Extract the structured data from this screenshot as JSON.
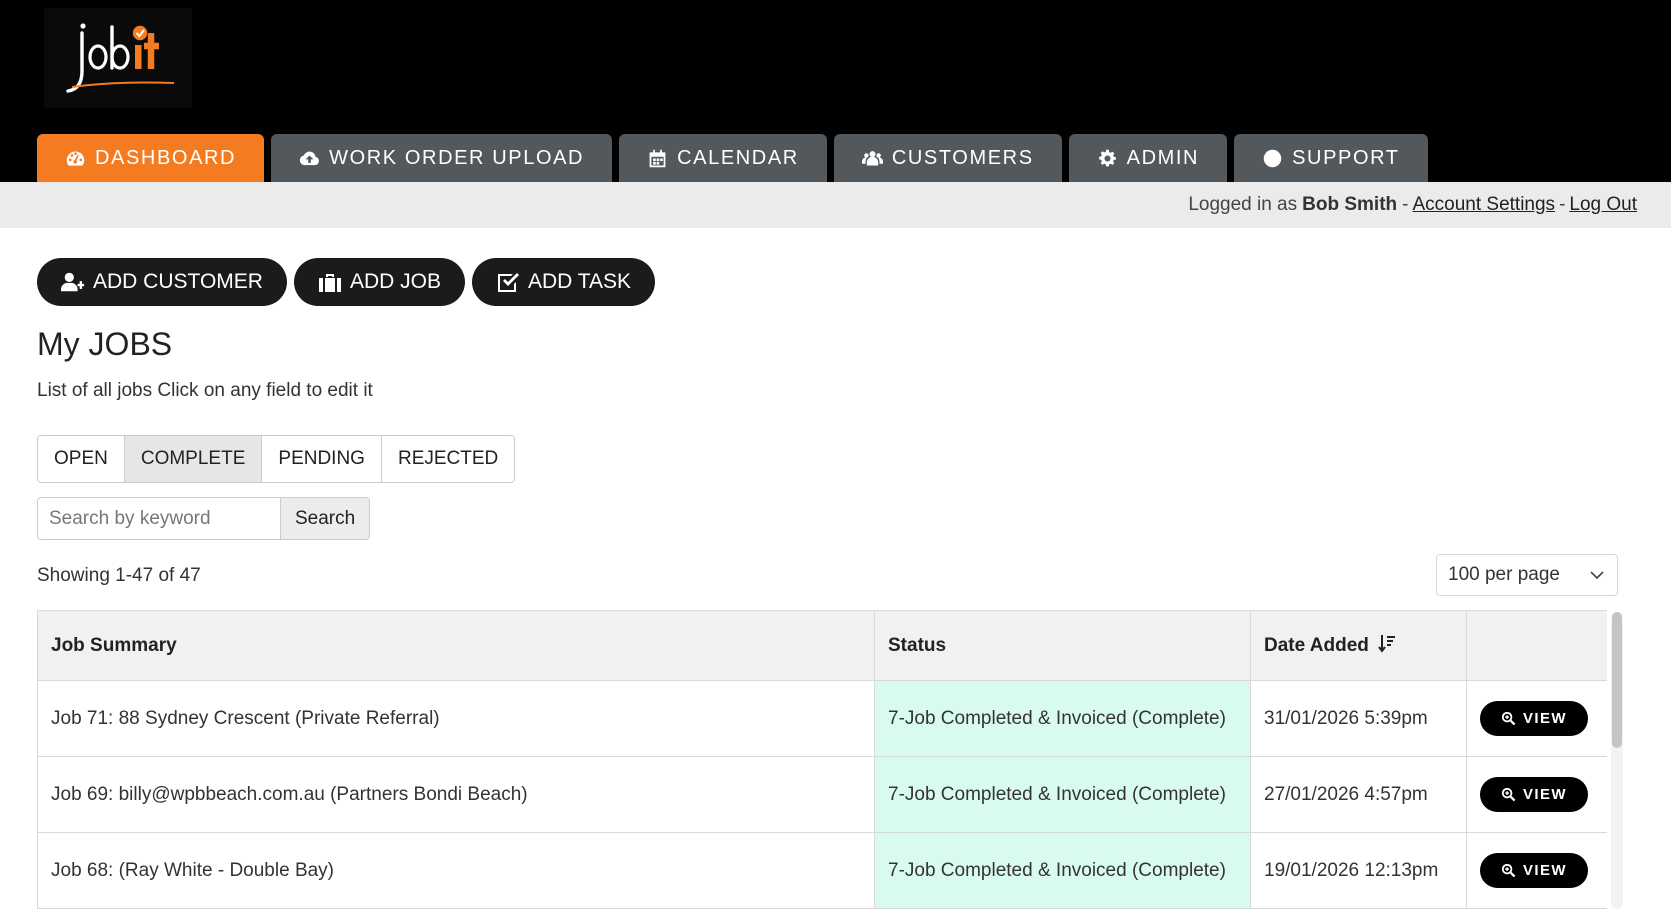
{
  "brand": {
    "logo_text": "jobit",
    "logo_main": "job",
    "logo_accent": "it",
    "accent_color": "#f47b20"
  },
  "nav": {
    "tabs": [
      {
        "label": "DASHBOARD",
        "icon": "dashboard-icon",
        "active": true
      },
      {
        "label": "WORK ORDER UPLOAD",
        "icon": "cloud-upload-icon"
      },
      {
        "label": "CALENDAR",
        "icon": "calendar-icon"
      },
      {
        "label": "CUSTOMERS",
        "icon": "users-icon"
      },
      {
        "label": "ADMIN",
        "icon": "gear-icon"
      },
      {
        "label": "SUPPORT",
        "icon": "lifebuoy-icon"
      }
    ]
  },
  "userbar": {
    "prefix": "Logged in as",
    "user": "Bob Smith",
    "sep1": "-",
    "account_settings": "Account Settings",
    "sep2": "-",
    "logout": "Log Out"
  },
  "actions": {
    "add_customer": "ADD CUSTOMER",
    "add_job": "ADD JOB",
    "add_task": "ADD TASK"
  },
  "page": {
    "title": "My JOBS",
    "subtitle": "List of all jobs Click on any field to edit it"
  },
  "filters": {
    "items": [
      "OPEN",
      "COMPLETE",
      "PENDING",
      "REJECTED"
    ],
    "active": "COMPLETE"
  },
  "search": {
    "placeholder": "Search by keyword",
    "button": "Search"
  },
  "listing": {
    "showing": "Showing 1-47 of 47",
    "per_page": "100 per page"
  },
  "table": {
    "headers": {
      "summary": "Job Summary",
      "status": "Status",
      "date": "Date Added",
      "action": ""
    },
    "status_color": "#d9fbef",
    "rows": [
      {
        "summary": "Job 71: 88 Sydney Crescent (Private Referral)",
        "status": "7-Job Completed & Invoiced (Complete)",
        "date": "31/01/2026 5:39pm",
        "action": "VIEW"
      },
      {
        "summary": "Job 69: billy@wpbbeach.com.au (Partners Bondi Beach)",
        "status": "7-Job Completed & Invoiced (Complete)",
        "date": "27/01/2026 4:57pm",
        "action": "VIEW"
      },
      {
        "summary": "Job 68: (Ray White - Double Bay)",
        "status": "7-Job Completed & Invoiced (Complete)",
        "date": "19/01/2026 12:13pm",
        "action": "VIEW"
      }
    ]
  }
}
